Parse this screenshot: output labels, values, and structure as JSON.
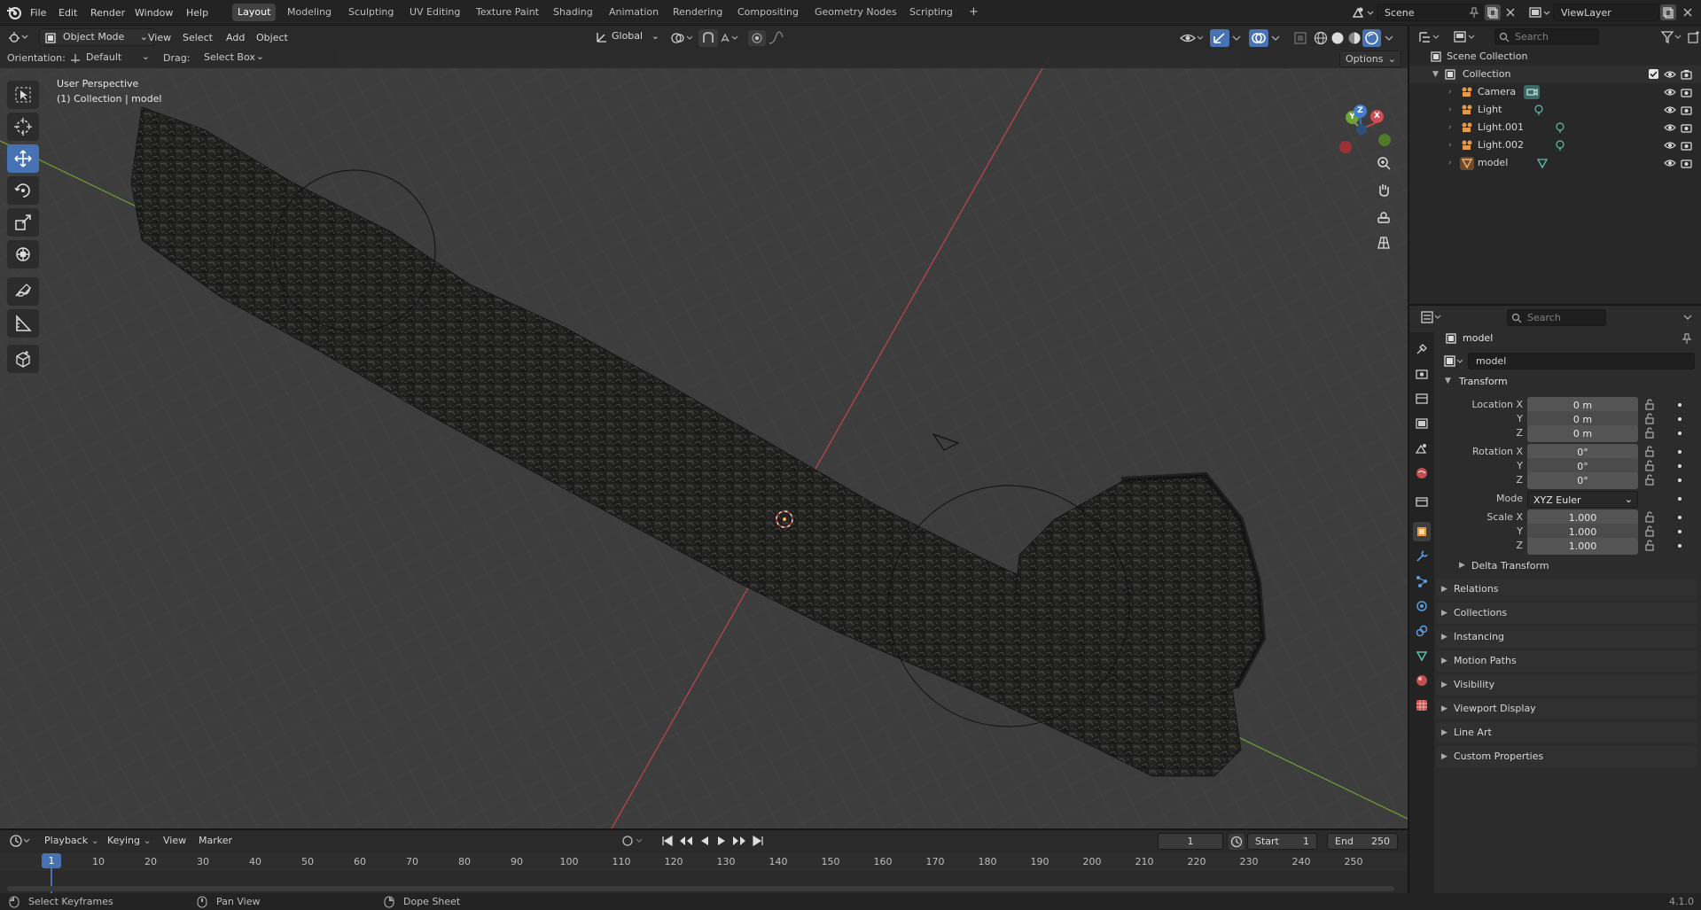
{
  "topbar": {
    "menus": [
      "File",
      "Edit",
      "Render",
      "Window",
      "Help"
    ],
    "workspaces": [
      "Layout",
      "Modeling",
      "Sculpting",
      "UV Editing",
      "Texture Paint",
      "Shading",
      "Animation",
      "Rendering",
      "Compositing",
      "Geometry Nodes",
      "Scripting"
    ],
    "active_workspace": "Layout",
    "add_tab": "+",
    "scene": "Scene",
    "view_layer": "ViewLayer"
  },
  "viewport_header": {
    "mode": "Object Mode",
    "menus": [
      "View",
      "Select",
      "Add",
      "Object"
    ],
    "transform_orientation": "Global",
    "options": "Options"
  },
  "tool_settings": {
    "orientation_label": "Orientation:",
    "orientation": "Default",
    "drag_label": "Drag:",
    "drag": "Select Box"
  },
  "viewport": {
    "view_name": "User Perspective",
    "collection_info": "(1) Collection | model",
    "gizmo": {
      "x": "X",
      "y": "Y",
      "z": "Z"
    }
  },
  "outliner": {
    "search_placeholder": "Search",
    "root": "Scene Collection",
    "collection": "Collection",
    "items": [
      {
        "name": "Camera",
        "icon": "camera-icon"
      },
      {
        "name": "Light",
        "icon": "light-icon"
      },
      {
        "name": "Light.001",
        "icon": "light-icon"
      },
      {
        "name": "Light.002",
        "icon": "light-icon"
      },
      {
        "name": "model",
        "icon": "mesh-icon"
      }
    ]
  },
  "properties": {
    "search_placeholder": "Search",
    "object_name": "model",
    "datablock_name": "model",
    "transform": {
      "title": "Transform",
      "location_label": "Location X",
      "location": [
        "0 m",
        "0 m",
        "0 m"
      ],
      "rotation_label": "Rotation X",
      "rotation": [
        "0°",
        "0°",
        "0°"
      ],
      "mode_label": "Mode",
      "mode": "XYZ Euler",
      "scale_label": "Scale X",
      "scale": [
        "1.000",
        "1.000",
        "1.000"
      ],
      "axis_y": "Y",
      "axis_z": "Z",
      "delta": "Delta Transform"
    },
    "sections": [
      "Relations",
      "Collections",
      "Instancing",
      "Motion Paths",
      "Visibility",
      "Viewport Display",
      "Line Art",
      "Custom Properties"
    ]
  },
  "timeline": {
    "menus": [
      "Playback",
      "Keying",
      "View",
      "Marker"
    ],
    "current_frame": "1",
    "start_label": "Start",
    "start": "1",
    "end_label": "End",
    "end": "250",
    "frame_labels": [
      "10",
      "20",
      "30",
      "40",
      "50",
      "60",
      "70",
      "80",
      "90",
      "100",
      "110",
      "120",
      "130",
      "140",
      "150",
      "160",
      "170",
      "180",
      "190",
      "200",
      "210",
      "220",
      "230",
      "240",
      "250"
    ]
  },
  "statusbar": {
    "left": "Select Keyframes",
    "middle": "Pan View",
    "right": "Dope Sheet",
    "version": "4.1.0"
  }
}
